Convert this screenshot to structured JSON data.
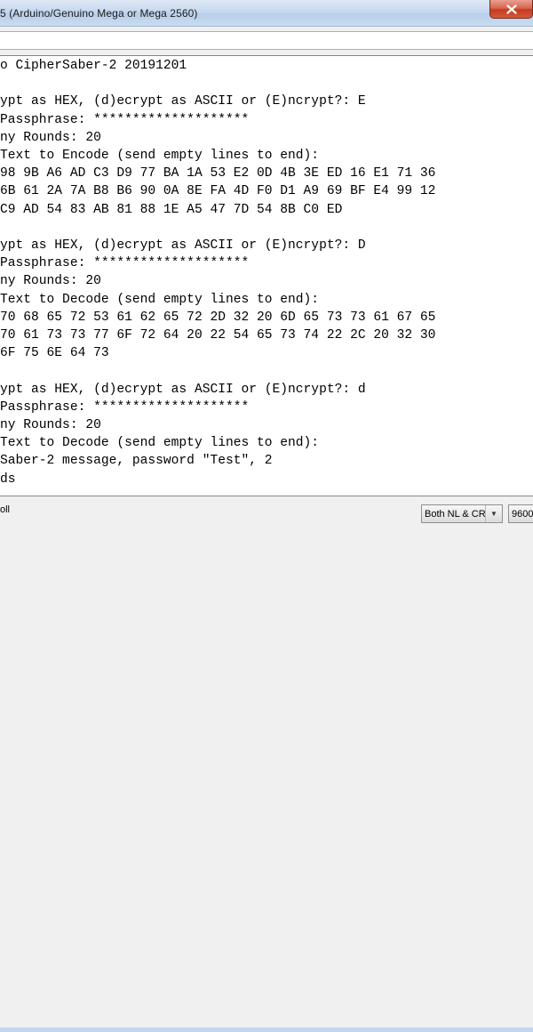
{
  "window": {
    "title": "5 (Arduino/Genuino Mega or Mega 2560)"
  },
  "input": {
    "value": ""
  },
  "output_lines": [
    "o CipherSaber-2 20191201",
    "",
    "ypt as HEX, (d)ecrypt as ASCII or (E)ncrypt?: E",
    "Passphrase: ********************",
    "ny Rounds: 20",
    "Text to Encode (send empty lines to end):",
    "98 9B A6 AD C3 D9 77 BA 1A 53 E2 0D 4B 3E ED 16 E1 71 36",
    "6B 61 2A 7A B8 B6 90 0A 8E FA 4D F0 D1 A9 69 BF E4 99 12",
    "C9 AD 54 83 AB 81 88 1E A5 47 7D 54 8B C0 ED",
    "",
    "ypt as HEX, (d)ecrypt as ASCII or (E)ncrypt?: D",
    "Passphrase: ********************",
    "ny Rounds: 20",
    "Text to Decode (send empty lines to end):",
    "70 68 65 72 53 61 62 65 72 2D 32 20 6D 65 73 73 61 67 65",
    "70 61 73 73 77 6F 72 64 20 22 54 65 73 74 22 2C 20 32 30",
    "6F 75 6E 64 73",
    "",
    "ypt as HEX, (d)ecrypt as ASCII or (E)ncrypt?: d",
    "Passphrase: ********************",
    "ny Rounds: 20",
    "Text to Decode (send empty lines to end):",
    "Saber-2 message, password \"Test\", 2",
    "ds"
  ],
  "status": {
    "autoscroll_label": "oll",
    "line_ending": "Both NL & CR",
    "baud": "9600"
  }
}
